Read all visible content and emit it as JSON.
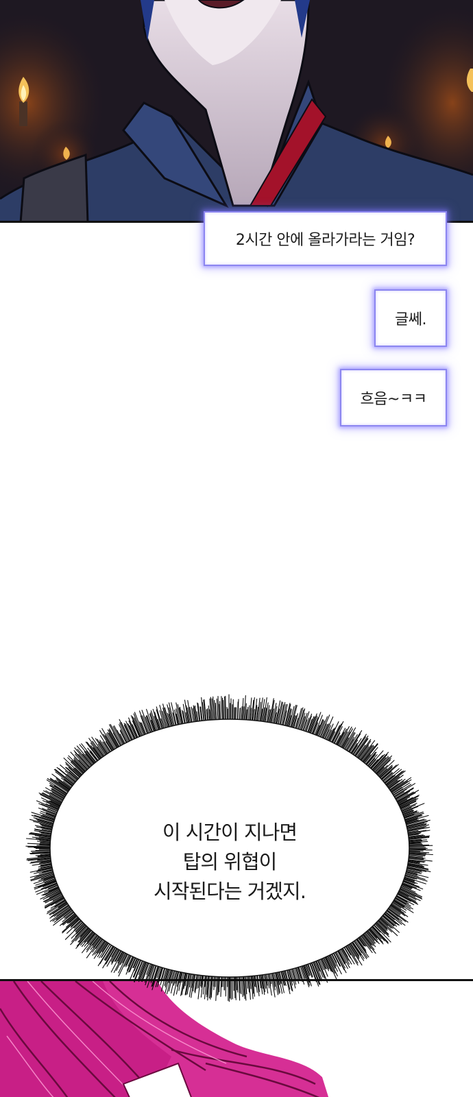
{
  "system_boxes": [
    {
      "text": "2시간 안에 올라가라는 거임?"
    },
    {
      "text": "글쎄."
    },
    {
      "text": "흐음~ㅋㅋ"
    }
  ],
  "thought_bubble": {
    "lines": [
      "이 시간이 지나면",
      "탑의 위협이",
      "시작된다는 거겠지."
    ]
  },
  "colors": {
    "box_glow": "#8c86f0",
    "top_panel_bg": "#1b1620",
    "bottom_panel_hair": "#e0188a"
  }
}
